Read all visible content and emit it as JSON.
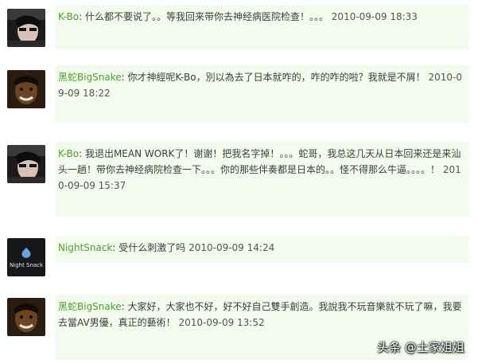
{
  "comments": [
    {
      "avatar": "avatar-kbo",
      "author": "K-Bo",
      "separator": ":",
      "text": " 什么都不要说了。。等我回来带你去神经病医院检查！。。。",
      "time": "2010-09-09 18:33"
    },
    {
      "avatar": "avatar-bigsnake",
      "author": "黑蛇BigSnake",
      "separator": ":",
      "text": " 你才神經呢K-Bo，別以為去了日本就咋的，咋的咋的啦？我就是不屑！",
      "time": "2010-09-09 18:22"
    },
    {
      "avatar": "avatar-kbo",
      "author": "K-Bo",
      "separator": ":",
      "text": " 我退出MEAN WORK了！谢谢！把我名字掉！。。。蛇哥，我总这几天从日本回来还是来汕头一趟！带你去神经病院检查一下。。。你的那些伴奏都是日本的。。怪不得那么牛逼。。。。！",
      "time": "2010-09-09 15:37"
    },
    {
      "avatar": "avatar-nightsnack",
      "avatar_label": "Night Snack",
      "author": "NightSnack",
      "separator": ":",
      "text": " 受什么刺激了吗",
      "time": "2010-09-09 14:24"
    },
    {
      "avatar": "avatar-bigsnake",
      "author": "黑蛇BigSnake",
      "separator": ":",
      "text": " 大家好，大家也不好，好不好自己雙手創造。我說我不玩音樂就不玩了嘛，我要去當AV男優，真正的藝術！",
      "time": "2010-09-09 13:52"
    }
  ],
  "watermark": "头条 @土家姐姐",
  "colors": {
    "bubble": "#f2fbee",
    "author": "#4d9f2f",
    "text": "#3c3c3c"
  }
}
